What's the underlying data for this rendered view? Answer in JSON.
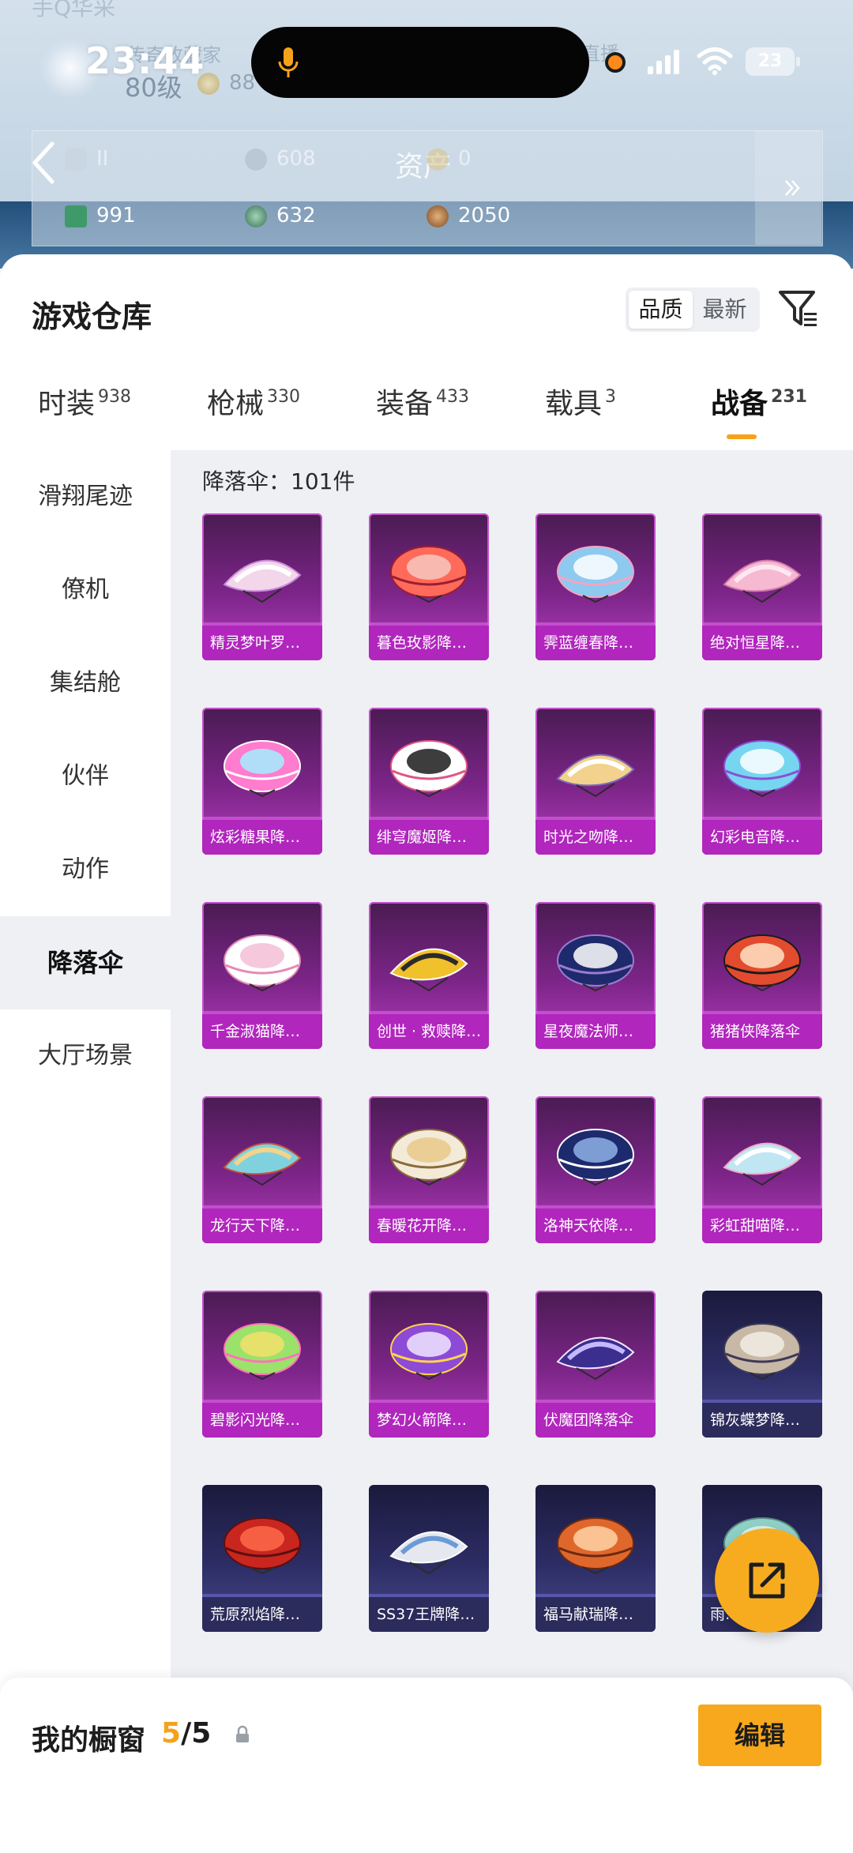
{
  "status_bar": {
    "time": "23:44",
    "battery": "23"
  },
  "game_header": {
    "faded_title": "手Q华采",
    "collector_text": "传奇收藏家",
    "level": "80级",
    "coins": "88",
    "live_text": "直播",
    "assets_title": "资产",
    "assets": [
      {
        "name": "asset-1",
        "value": "II"
      },
      {
        "name": "asset-2",
        "value": "608"
      },
      {
        "name": "asset-3",
        "value": "0"
      },
      {
        "name": "asset-4",
        "value": "991"
      },
      {
        "name": "asset-5",
        "value": "632"
      },
      {
        "name": "asset-6",
        "value": "2050"
      }
    ]
  },
  "warehouse": {
    "title": "游戏仓库",
    "sort_options": [
      "品质",
      "最新"
    ],
    "categories": [
      {
        "label": "时装",
        "count": "938"
      },
      {
        "label": "枪械",
        "count": "330"
      },
      {
        "label": "装备",
        "count": "433"
      },
      {
        "label": "载具",
        "count": "3"
      },
      {
        "label": "战备",
        "count": "231"
      }
    ],
    "sidebar": [
      "滑翔尾迹",
      "僚机",
      "集结舱",
      "伙伴",
      "动作",
      "降落伞",
      "大厅场景"
    ],
    "count_label": "降落伞：101件",
    "items": [
      "精灵梦叶罗…",
      "暮色玫影降…",
      "霁蓝缠春降…",
      "绝对恒星降…",
      "炫彩糖果降…",
      "绯穹魔姬降…",
      "时光之吻降…",
      "幻彩电音降…",
      "千金淑猫降…",
      "创世 · 救赎降…",
      "星夜魔法师…",
      "猪猪侠降落伞",
      "龙行天下降…",
      "春暖花开降…",
      "洛神天依降…",
      "彩虹甜喵降…",
      "碧影闪光降…",
      "梦幻火箭降…",
      "伏魔团降落伞",
      "锦灰蝶梦降…",
      "荒原烈焰降…",
      "SS37王牌降…",
      "福马献瑞降…",
      "雨…"
    ]
  },
  "showcase": {
    "label": "我的橱窗",
    "current": "5",
    "total": "/5",
    "edit_label": "编辑"
  },
  "colors": {
    "accent": "#f5a21b",
    "card_purple": "#b126bd",
    "card_blue": "#2b2b5c"
  }
}
